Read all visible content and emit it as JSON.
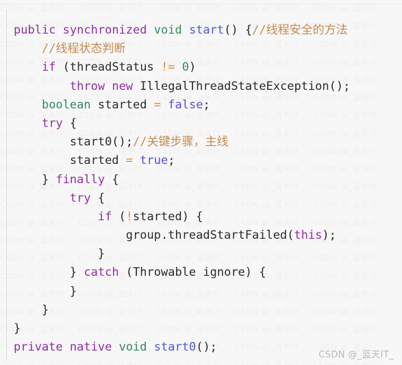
{
  "colors": {
    "background": "#f7f7f7",
    "keyword": "#8f2fa3",
    "type": "#2e8b63",
    "function": "#4f56d6",
    "literal": "#5a4fd6",
    "operator": "#e08a3c",
    "comment": "#c58a52",
    "plain": "#2a2a2a",
    "gutter_rule": "#dcdcdc",
    "watermark": "#b8b8b8"
  },
  "watermark": {
    "text": "CSDN @_蓝天IT_",
    "background_tile": "CSDN @_蓝天IT_   "
  },
  "code": {
    "language": "java",
    "lines": [
      {
        "indent": 0,
        "tokens": [
          {
            "t": "public",
            "c": "kw"
          },
          {
            "t": " ",
            "c": "pl"
          },
          {
            "t": "synchronized",
            "c": "kw"
          },
          {
            "t": " ",
            "c": "pl"
          },
          {
            "t": "void",
            "c": "typ"
          },
          {
            "t": " ",
            "c": "pl"
          },
          {
            "t": "start",
            "c": "fn"
          },
          {
            "t": "() {",
            "c": "pl"
          },
          {
            "t": "//线程安全的方法",
            "c": "cmt"
          }
        ]
      },
      {
        "indent": 1,
        "tokens": [
          {
            "t": "//线程状态判断",
            "c": "cmt"
          }
        ]
      },
      {
        "indent": 1,
        "tokens": [
          {
            "t": "if",
            "c": "kw"
          },
          {
            "t": " (",
            "c": "pl"
          },
          {
            "t": "threadStatus",
            "c": "pl"
          },
          {
            "t": " ",
            "c": "pl"
          },
          {
            "t": "!=",
            "c": "op"
          },
          {
            "t": " ",
            "c": "pl"
          },
          {
            "t": "0",
            "c": "typ"
          },
          {
            "t": ")",
            "c": "pl"
          }
        ]
      },
      {
        "indent": 2,
        "tokens": [
          {
            "t": "throw",
            "c": "kw"
          },
          {
            "t": " ",
            "c": "pl"
          },
          {
            "t": "new",
            "c": "kw"
          },
          {
            "t": " ",
            "c": "pl"
          },
          {
            "t": "IllegalThreadStateException();",
            "c": "pl"
          }
        ]
      },
      {
        "indent": 1,
        "tokens": [
          {
            "t": "boolean",
            "c": "typ"
          },
          {
            "t": " ",
            "c": "pl"
          },
          {
            "t": "started",
            "c": "pl"
          },
          {
            "t": " ",
            "c": "pl"
          },
          {
            "t": "=",
            "c": "op"
          },
          {
            "t": " ",
            "c": "pl"
          },
          {
            "t": "false",
            "c": "lit"
          },
          {
            "t": ";",
            "c": "pl"
          }
        ]
      },
      {
        "indent": 1,
        "tokens": [
          {
            "t": "try",
            "c": "kw"
          },
          {
            "t": " {",
            "c": "pl"
          }
        ]
      },
      {
        "indent": 2,
        "tokens": [
          {
            "t": "start0();",
            "c": "pl"
          },
          {
            "t": "//关键步骤，主线",
            "c": "cmt"
          }
        ]
      },
      {
        "indent": 2,
        "tokens": [
          {
            "t": "started",
            "c": "pl"
          },
          {
            "t": " ",
            "c": "pl"
          },
          {
            "t": "=",
            "c": "op"
          },
          {
            "t": " ",
            "c": "pl"
          },
          {
            "t": "true",
            "c": "lit"
          },
          {
            "t": ";",
            "c": "pl"
          }
        ]
      },
      {
        "indent": 1,
        "tokens": [
          {
            "t": "} ",
            "c": "pl"
          },
          {
            "t": "finally",
            "c": "kw"
          },
          {
            "t": " {",
            "c": "pl"
          }
        ]
      },
      {
        "indent": 2,
        "tokens": [
          {
            "t": "try",
            "c": "kw"
          },
          {
            "t": " {",
            "c": "pl"
          }
        ]
      },
      {
        "indent": 3,
        "tokens": [
          {
            "t": "if",
            "c": "kw"
          },
          {
            "t": " (",
            "c": "pl"
          },
          {
            "t": "!",
            "c": "op"
          },
          {
            "t": "started) {",
            "c": "pl"
          }
        ]
      },
      {
        "indent": 4,
        "tokens": [
          {
            "t": "group.threadStartFailed(",
            "c": "pl"
          },
          {
            "t": "this",
            "c": "kw"
          },
          {
            "t": ");",
            "c": "pl"
          }
        ]
      },
      {
        "indent": 3,
        "tokens": [
          {
            "t": "}",
            "c": "pl"
          }
        ]
      },
      {
        "indent": 2,
        "tokens": [
          {
            "t": "} ",
            "c": "pl"
          },
          {
            "t": "catch",
            "c": "kw"
          },
          {
            "t": " (Throwable ignore) {",
            "c": "pl"
          }
        ]
      },
      {
        "indent": 2,
        "tokens": [
          {
            "t": "}",
            "c": "pl"
          }
        ]
      },
      {
        "indent": 1,
        "tokens": [
          {
            "t": "}",
            "c": "pl"
          }
        ]
      },
      {
        "indent": 0,
        "tokens": [
          {
            "t": "}",
            "c": "pl"
          }
        ]
      },
      {
        "indent": 0,
        "tokens": [
          {
            "t": "private",
            "c": "kw"
          },
          {
            "t": " ",
            "c": "pl"
          },
          {
            "t": "native",
            "c": "kw"
          },
          {
            "t": " ",
            "c": "pl"
          },
          {
            "t": "void",
            "c": "typ"
          },
          {
            "t": " ",
            "c": "pl"
          },
          {
            "t": "start0",
            "c": "fn"
          },
          {
            "t": "();",
            "c": "pl"
          }
        ]
      }
    ]
  }
}
